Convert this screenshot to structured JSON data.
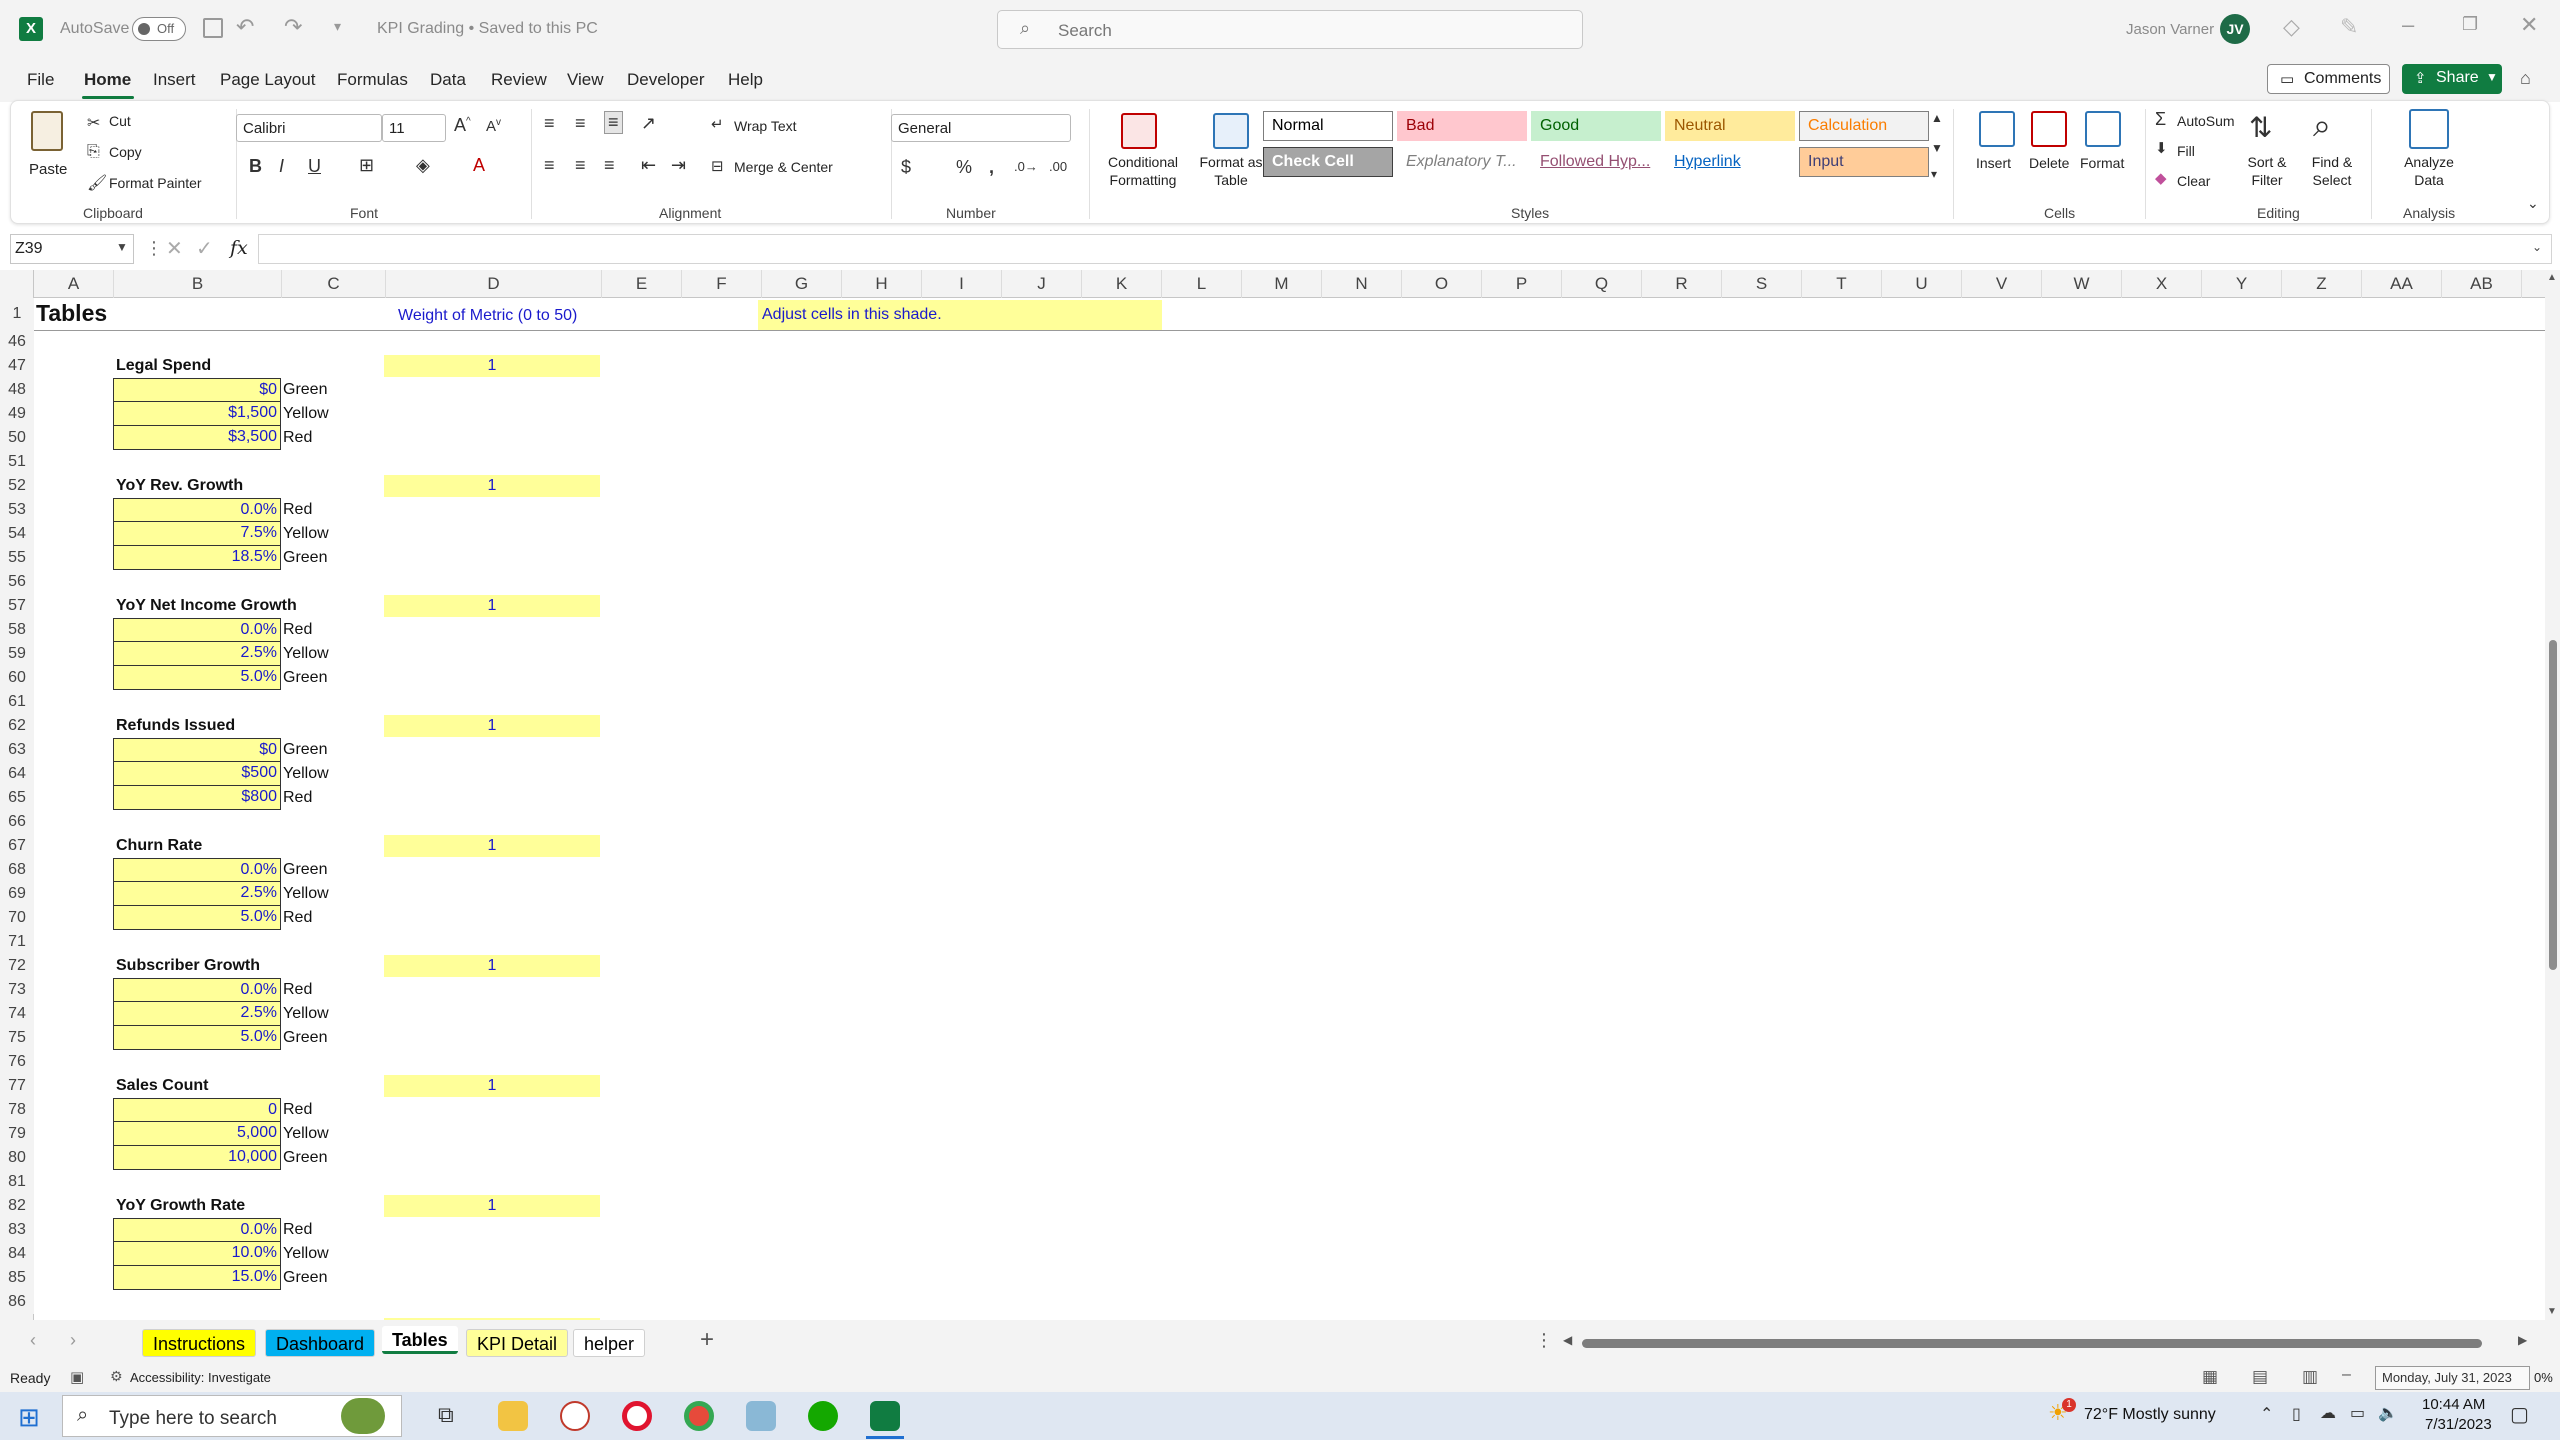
{
  "titlebar": {
    "autosave_label": "AutoSave",
    "autosave_state": "Off",
    "document_title": "KPI Grading • Saved to this PC",
    "search_placeholder": "Search",
    "user_name": "Jason Varner",
    "user_initials": "JV"
  },
  "menu": {
    "items": [
      "File",
      "Home",
      "Insert",
      "Page Layout",
      "Formulas",
      "Data",
      "Review",
      "View",
      "Developer",
      "Help"
    ],
    "comments_label": "Comments",
    "share_label": "Share"
  },
  "ribbon": {
    "clipboard": {
      "paste": "Paste",
      "cut": "Cut",
      "copy": "Copy",
      "format_painter": "Format Painter",
      "label": "Clipboard"
    },
    "font": {
      "name": "Calibri",
      "size": "11",
      "label": "Font"
    },
    "alignment": {
      "wrap": "Wrap Text",
      "merge": "Merge & Center",
      "label": "Alignment"
    },
    "number": {
      "format": "General",
      "label": "Number"
    },
    "styles": {
      "conditional": "Conditional Formatting",
      "format_table": "Format as Table",
      "label": "Styles",
      "cells": [
        {
          "text": "Normal",
          "bg": "#ffffff",
          "fg": "#000000",
          "border": "#7d7d7d"
        },
        {
          "text": "Bad",
          "bg": "#ffc7ce",
          "fg": "#9c0006",
          "border": "#ffc7ce"
        },
        {
          "text": "Good",
          "bg": "#c6efce",
          "fg": "#006100",
          "border": "#c6efce"
        },
        {
          "text": "Neutral",
          "bg": "#ffeb9c",
          "fg": "#9c5700",
          "border": "#ffeb9c"
        },
        {
          "text": "Calculation",
          "bg": "#f2f2f2",
          "fg": "#fa7d00",
          "border": "#7f7f7f"
        },
        {
          "text": "Check Cell",
          "bg": "#a5a5a5",
          "fg": "#ffffff",
          "border": "#3f3f3f"
        },
        {
          "text": "Explanatory T...",
          "bg": "#ffffff",
          "fg": "#7f7f7f",
          "border": "#ffffff"
        },
        {
          "text": "Followed Hyp...",
          "bg": "#ffffff",
          "fg": "#954f72",
          "border": "#ffffff"
        },
        {
          "text": "Hyperlink",
          "bg": "#ffffff",
          "fg": "#0563c1",
          "border": "#ffffff"
        },
        {
          "text": "Input",
          "bg": "#ffcc99",
          "fg": "#3f3f76",
          "border": "#7f7f7f"
        }
      ]
    },
    "cells": {
      "insert": "Insert",
      "delete": "Delete",
      "format": "Format",
      "label": "Cells"
    },
    "editing": {
      "autosum": "AutoSum",
      "fill": "Fill",
      "clear": "Clear",
      "sort": "Sort & Filter",
      "find": "Find & Select",
      "label": "Editing"
    },
    "analysis": {
      "analyze": "Analyze Data",
      "label": "Analysis"
    }
  },
  "formula_bar": {
    "name_box": "Z39",
    "fx": "fx",
    "value": ""
  },
  "columns": [
    "A",
    "B",
    "C",
    "D",
    "E",
    "F",
    "G",
    "H",
    "I",
    "J",
    "K",
    "L",
    "M",
    "N",
    "O",
    "P",
    "Q",
    "R",
    "S",
    "T",
    "U",
    "V",
    "W",
    "X",
    "Y",
    "Z",
    "AA",
    "AB"
  ],
  "sheet": {
    "title": "Tables",
    "weight_header": "Weight of Metric (0 to 50)",
    "adjust_note": "Adjust cells in this shade.",
    "rows": [
      "1",
      "46",
      "47",
      "48",
      "49",
      "50",
      "51",
      "52",
      "53",
      "54",
      "55",
      "56",
      "57",
      "58",
      "59",
      "60",
      "61",
      "62",
      "63",
      "64",
      "65",
      "66",
      "67",
      "68",
      "69",
      "70",
      "71",
      "72",
      "73",
      "74",
      "75",
      "76",
      "77",
      "78",
      "79",
      "80",
      "81",
      "82",
      "83",
      "84",
      "85",
      "86"
    ],
    "metrics": [
      {
        "name": "Legal Spend",
        "weight": "1",
        "values": [
          "$0",
          "$1,500",
          "$3,500"
        ],
        "labels": [
          "Green",
          "Yellow",
          "Red"
        ]
      },
      {
        "name": "YoY Rev. Growth",
        "weight": "1",
        "values": [
          "0.0%",
          "7.5%",
          "18.5%"
        ],
        "labels": [
          "Red",
          "Yellow",
          "Green"
        ]
      },
      {
        "name": "YoY Net Income Growth",
        "weight": "1",
        "values": [
          "0.0%",
          "2.5%",
          "5.0%"
        ],
        "labels": [
          "Red",
          "Yellow",
          "Green"
        ]
      },
      {
        "name": "Refunds Issued",
        "weight": "1",
        "values": [
          "$0",
          "$500",
          "$800"
        ],
        "labels": [
          "Green",
          "Yellow",
          "Red"
        ]
      },
      {
        "name": "Churn Rate",
        "weight": "1",
        "values": [
          "0.0%",
          "2.5%",
          "5.0%"
        ],
        "labels": [
          "Green",
          "Yellow",
          "Red"
        ]
      },
      {
        "name": "Subscriber Growth",
        "weight": "1",
        "values": [
          "0.0%",
          "2.5%",
          "5.0%"
        ],
        "labels": [
          "Red",
          "Yellow",
          "Green"
        ]
      },
      {
        "name": "Sales Count",
        "weight": "1",
        "values": [
          "0",
          "5,000",
          "10,000"
        ],
        "labels": [
          "Red",
          "Yellow",
          "Green"
        ]
      },
      {
        "name": "YoY Growth Rate",
        "weight": "1",
        "values": [
          "0.0%",
          "10.0%",
          "15.0%"
        ],
        "labels": [
          "Red",
          "Yellow",
          "Green"
        ]
      }
    ]
  },
  "tabs": [
    {
      "label": "Instructions",
      "bg": "#ffff00",
      "fg": "#000000"
    },
    {
      "label": "Dashboard",
      "bg": "#00b0f0",
      "fg": "#000000"
    },
    {
      "label": "Tables",
      "bg": "#ffffff",
      "fg": "#000000"
    },
    {
      "label": "KPI Detail",
      "bg": "#ffff99",
      "fg": "#000000"
    },
    {
      "label": "helper",
      "bg": "#ffffff",
      "fg": "#000000"
    }
  ],
  "status": {
    "ready": "Ready",
    "accessibility": "Accessibility: Investigate",
    "tooltip": "Monday, July 31, 2023",
    "zoom": "0%"
  },
  "taskbar": {
    "search": "Type here to search",
    "weather": "72°F  Mostly sunny",
    "time": "10:44 AM",
    "date": "7/31/2023",
    "notif": "1"
  }
}
